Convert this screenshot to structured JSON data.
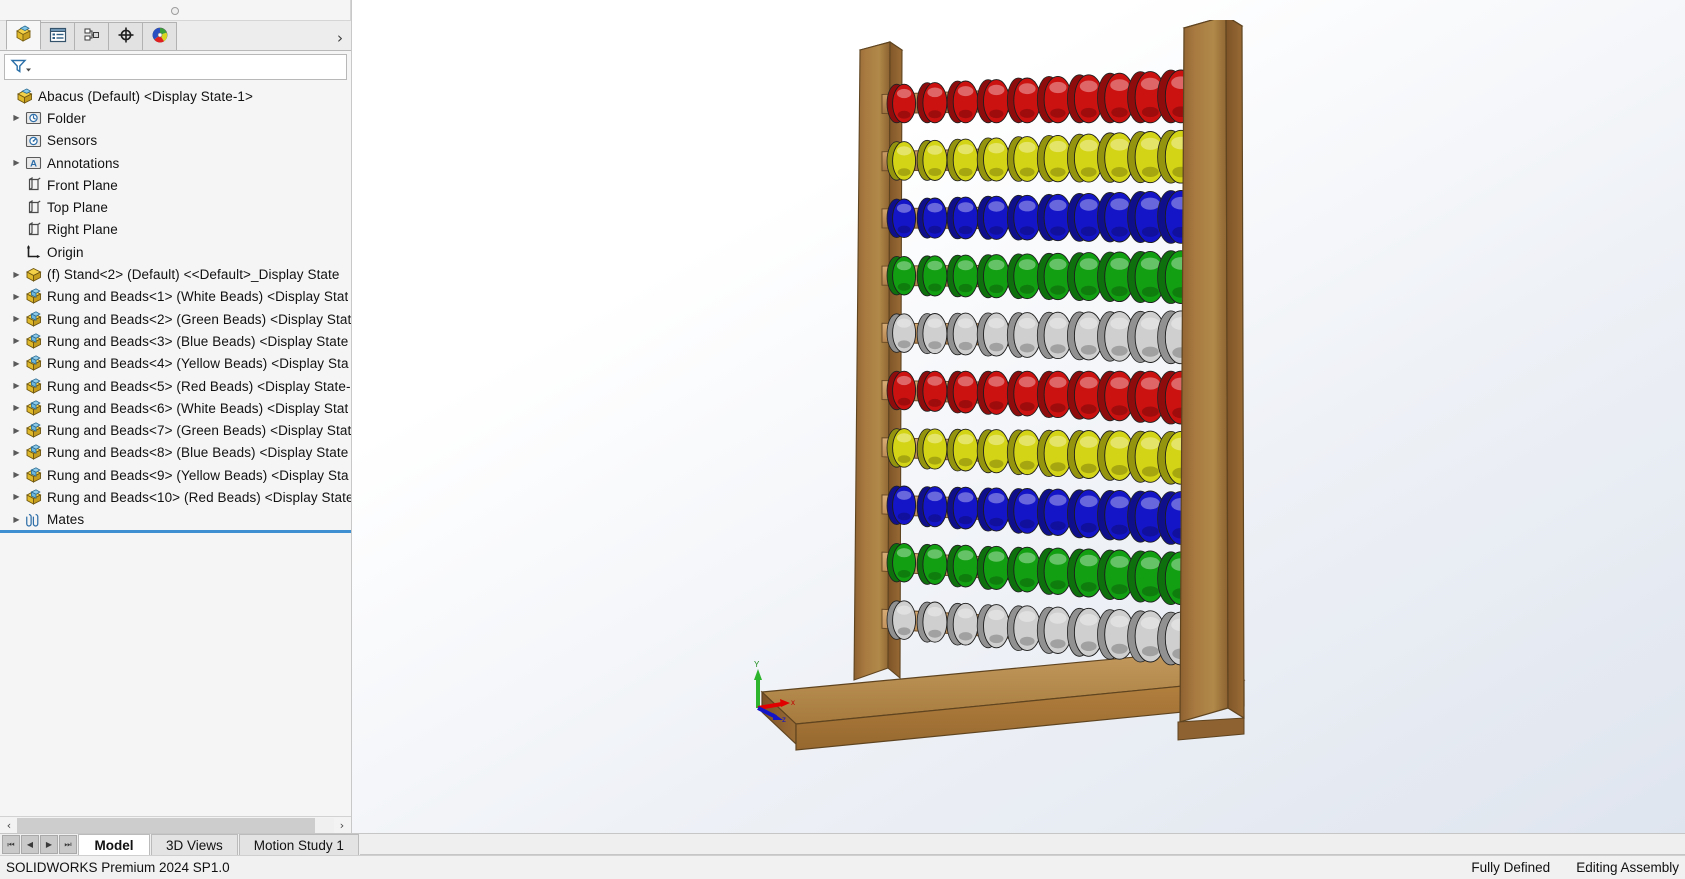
{
  "window": {
    "title": "Abacus (Default) <Display State-1>"
  },
  "feature_manager": {
    "tabs": [
      {
        "id": "feature-tree",
        "icon": "assembly-tree-icon",
        "active": true
      },
      {
        "id": "property-manager",
        "icon": "property-manager-icon",
        "active": false
      },
      {
        "id": "configuration-manager",
        "icon": "configuration-manager-icon",
        "active": false
      },
      {
        "id": "dimxpert-manager",
        "icon": "dimxpert-icon",
        "active": false
      },
      {
        "id": "display-manager",
        "icon": "display-manager-icon",
        "active": false
      }
    ],
    "overflow_label": "›",
    "filter": {
      "icon": "filter-icon",
      "value": "",
      "placeholder": ""
    },
    "tree": [
      {
        "label": "Abacus (Default) <Display State-1>",
        "icon": "assembly-icon",
        "arrow": false,
        "indent": 0,
        "name": "tree-item-abacus"
      },
      {
        "label": "Folder",
        "icon": "history-folder-icon",
        "arrow": true,
        "indent": 1,
        "name": "tree-item-history-folder"
      },
      {
        "label": "Sensors",
        "icon": "sensors-icon",
        "arrow": false,
        "indent": 1,
        "name": "tree-item-sensors"
      },
      {
        "label": "Annotations",
        "icon": "annotations-icon",
        "arrow": true,
        "indent": 1,
        "name": "tree-item-annotations"
      },
      {
        "label": "Front Plane",
        "icon": "plane-icon",
        "arrow": false,
        "indent": 1,
        "name": "tree-item-front-plane"
      },
      {
        "label": "Top Plane",
        "icon": "plane-icon",
        "arrow": false,
        "indent": 1,
        "name": "tree-item-top-plane"
      },
      {
        "label": "Right Plane",
        "icon": "plane-icon",
        "arrow": false,
        "indent": 1,
        "name": "tree-item-right-plane"
      },
      {
        "label": "Origin",
        "icon": "origin-icon",
        "arrow": false,
        "indent": 1,
        "name": "tree-item-origin"
      },
      {
        "label": "(f) Stand<2> (Default) <<Default>_Display State",
        "icon": "part-yellow-icon",
        "arrow": true,
        "indent": 1,
        "name": "tree-item-stand-2"
      },
      {
        "label": "Rung and Beads<1> (White Beads) <Display Stat",
        "icon": "part-assembly-icon",
        "arrow": true,
        "indent": 1,
        "name": "tree-item-rung-and-beads-1"
      },
      {
        "label": "Rung and Beads<2> (Green Beads) <Display Stat",
        "icon": "part-assembly-icon",
        "arrow": true,
        "indent": 1,
        "name": "tree-item-rung-and-beads-2"
      },
      {
        "label": "Rung and Beads<3> (Blue Beads) <Display State",
        "icon": "part-assembly-icon",
        "arrow": true,
        "indent": 1,
        "name": "tree-item-rung-and-beads-3"
      },
      {
        "label": "Rung and Beads<4> (Yellow Beads) <Display Sta",
        "icon": "part-assembly-icon",
        "arrow": true,
        "indent": 1,
        "name": "tree-item-rung-and-beads-4"
      },
      {
        "label": "Rung and Beads<5> (Red Beads) <Display State-",
        "icon": "part-assembly-icon",
        "arrow": true,
        "indent": 1,
        "name": "tree-item-rung-and-beads-5"
      },
      {
        "label": "Rung and Beads<6> (White Beads) <Display Stat",
        "icon": "part-assembly-icon",
        "arrow": true,
        "indent": 1,
        "name": "tree-item-rung-and-beads-6"
      },
      {
        "label": "Rung and Beads<7> (Green Beads) <Display Stat",
        "icon": "part-assembly-icon",
        "arrow": true,
        "indent": 1,
        "name": "tree-item-rung-and-beads-7"
      },
      {
        "label": "Rung and Beads<8> (Blue Beads) <Display State",
        "icon": "part-assembly-icon",
        "arrow": true,
        "indent": 1,
        "name": "tree-item-rung-and-beads-8"
      },
      {
        "label": "Rung and Beads<9> (Yellow Beads) <Display Sta",
        "icon": "part-assembly-icon",
        "arrow": true,
        "indent": 1,
        "name": "tree-item-rung-and-beads-9"
      },
      {
        "label": "Rung and Beads<10> (Red Beads) <Display State",
        "icon": "part-assembly-icon",
        "arrow": true,
        "indent": 1,
        "name": "tree-item-rung-and-beads-10"
      },
      {
        "label": "Mates",
        "icon": "mates-icon",
        "arrow": true,
        "indent": 1,
        "name": "tree-item-mates"
      }
    ],
    "hscroll": {
      "left_arrow": "‹",
      "right_arrow": "›"
    }
  },
  "graphics": {
    "triad": {
      "x_label": "x",
      "y_label": "Y",
      "z_label": "z",
      "x_color": "#e00000",
      "y_color": "#18a018",
      "z_color": "#1414c8"
    },
    "model": {
      "name": "Abacus",
      "frame_color": "#a9773f",
      "frame_dark": "#8a5f30",
      "base_color": "#b08044",
      "rung_color": "#c3935c",
      "rows": 10,
      "beads_per_row": 10,
      "row_colors": [
        "#cc1111",
        "#d4d416",
        "#1515c8",
        "#12a012",
        "#cfcfcf",
        "#cc1111",
        "#d4d416",
        "#1515c8",
        "#12a012",
        "#cfcfcf"
      ],
      "row_color_names": [
        "Red",
        "Yellow",
        "Blue",
        "Green",
        "White",
        "Red",
        "Yellow",
        "Blue",
        "Green",
        "White"
      ]
    }
  },
  "bottom_tabs": {
    "nav": [
      {
        "name": "first-sheet-button",
        "glyph": "⏮"
      },
      {
        "name": "previous-sheet-button",
        "glyph": "◀"
      },
      {
        "name": "next-sheet-button",
        "glyph": "▶"
      },
      {
        "name": "last-sheet-button",
        "glyph": "⏭"
      }
    ],
    "items": [
      {
        "label": "Model",
        "active": true
      },
      {
        "label": "3D Views",
        "active": false
      },
      {
        "label": "Motion Study 1",
        "active": false
      }
    ]
  },
  "status_bar": {
    "product": "SOLIDWORKS Premium 2024 SP1.0",
    "defined_state": "Fully Defined",
    "edit_mode": "Editing Assembly"
  }
}
